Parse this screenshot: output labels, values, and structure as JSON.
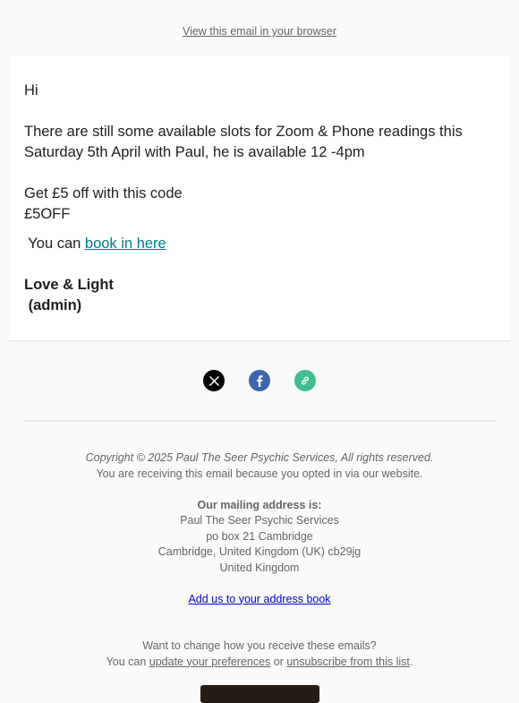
{
  "header": {
    "view_in_browser": "View this email in your browser"
  },
  "body": {
    "greeting": "Hi",
    "paragraph1": "There are still some available slots for Zoom & Phone readings this Saturday 5th April with Paul, he is available 12 -4pm",
    "offer_line": "Get £5 off with this code",
    "code": "£5OFF",
    "book_prefix": " You can ",
    "book_link": "book in here",
    "signoff": "Love & Light",
    "signoff_name": " (admin)"
  },
  "social": {
    "icons": [
      "x-icon",
      "facebook-icon",
      "link-icon"
    ]
  },
  "footer": {
    "copyright": "Copyright © 2025 Paul The Seer Psychic Services, All rights reserved.",
    "reason": "You are receiving this email because you opted in via our website.",
    "mailing_heading": "Our mailing address is:",
    "address": [
      "Paul The Seer Psychic Services",
      "po box 21 Cambridge",
      "Cambridge, United Kingdom (UK) cb29jg",
      "United Kingdom"
    ],
    "add_address_book": "Add us to your address book",
    "change_question": "Want to change how you receive these emails?",
    "change_prefix": "You can ",
    "update_prefs": "update your preferences",
    "or_text": " or ",
    "unsubscribe": "unsubscribe from this list",
    "period": "."
  },
  "colors": {
    "link": "#007c89",
    "x_bg": "#000000",
    "facebook_bg": "#3b65b0",
    "link_bg": "#3fbf8f"
  }
}
